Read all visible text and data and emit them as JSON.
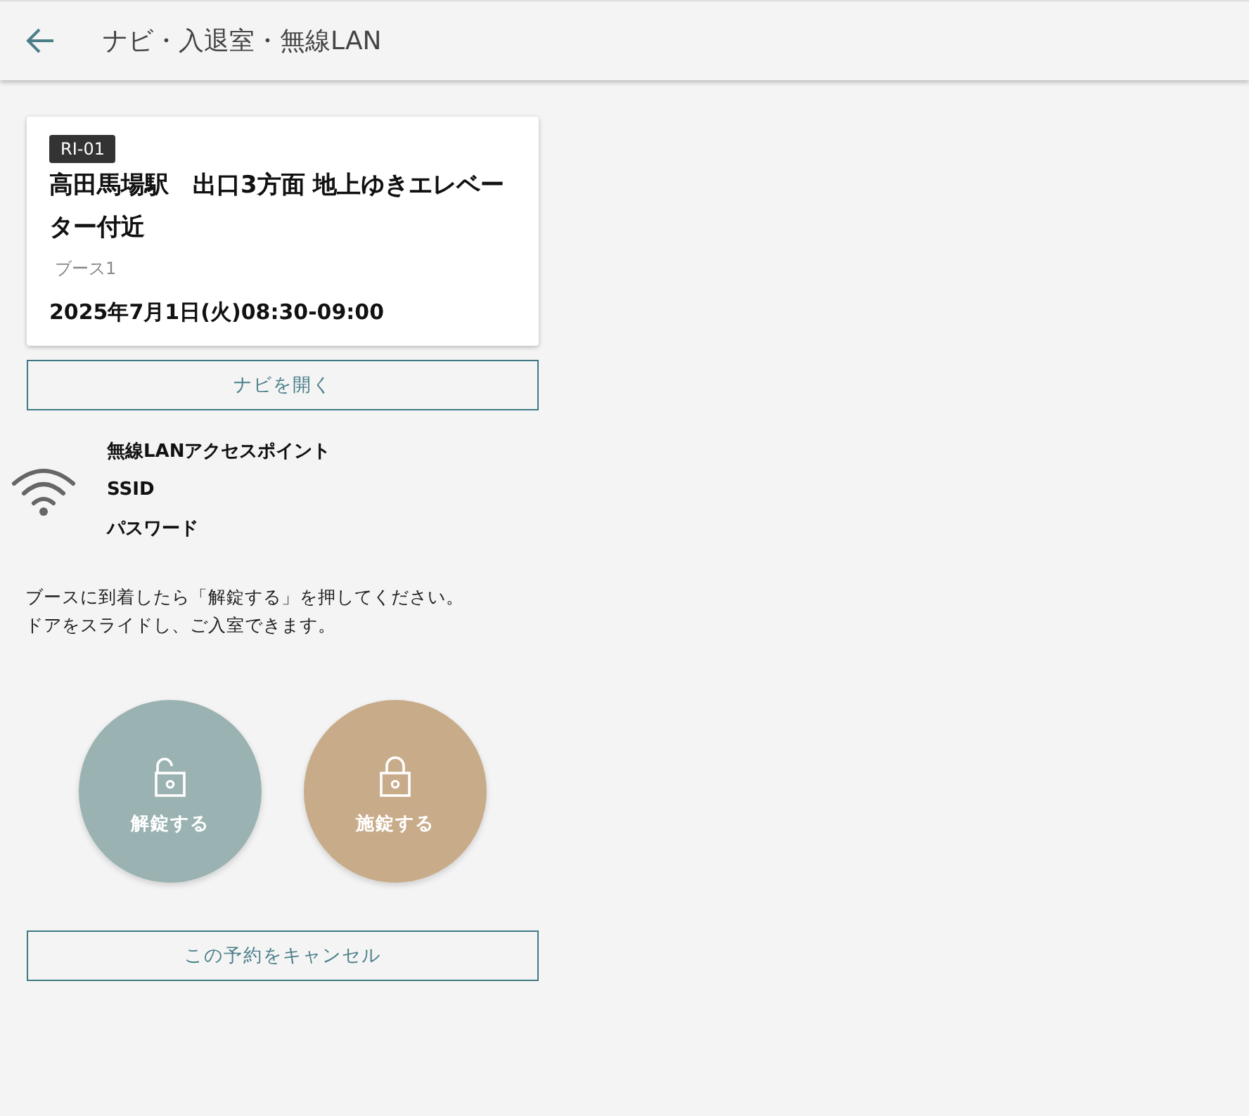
{
  "header": {
    "title": "ナビ・入退室・無線LAN"
  },
  "reservation": {
    "code": "RI-01",
    "place": "高田馬場駅　出口3方面 地上ゆきエレベーター付近",
    "booth": "ブース1",
    "datetime": "2025年7月1日(火)08:30-09:00"
  },
  "navi_button": "ナビを開く",
  "wifi": {
    "labels": [
      "無線LANアクセスポイント",
      "SSID",
      "パスワード"
    ]
  },
  "instructions": [
    "ブースに到着したら「解錠する」を押してください。",
    "ドアをスライドし、ご入室できます。"
  ],
  "lock_buttons": [
    {
      "kind": "unlock",
      "label": "解錠する",
      "color": "#9ab3b2"
    },
    {
      "kind": "lock",
      "label": "施錠する",
      "color": "#c8ab88"
    }
  ],
  "cancel_button": "この予約をキャンセル"
}
